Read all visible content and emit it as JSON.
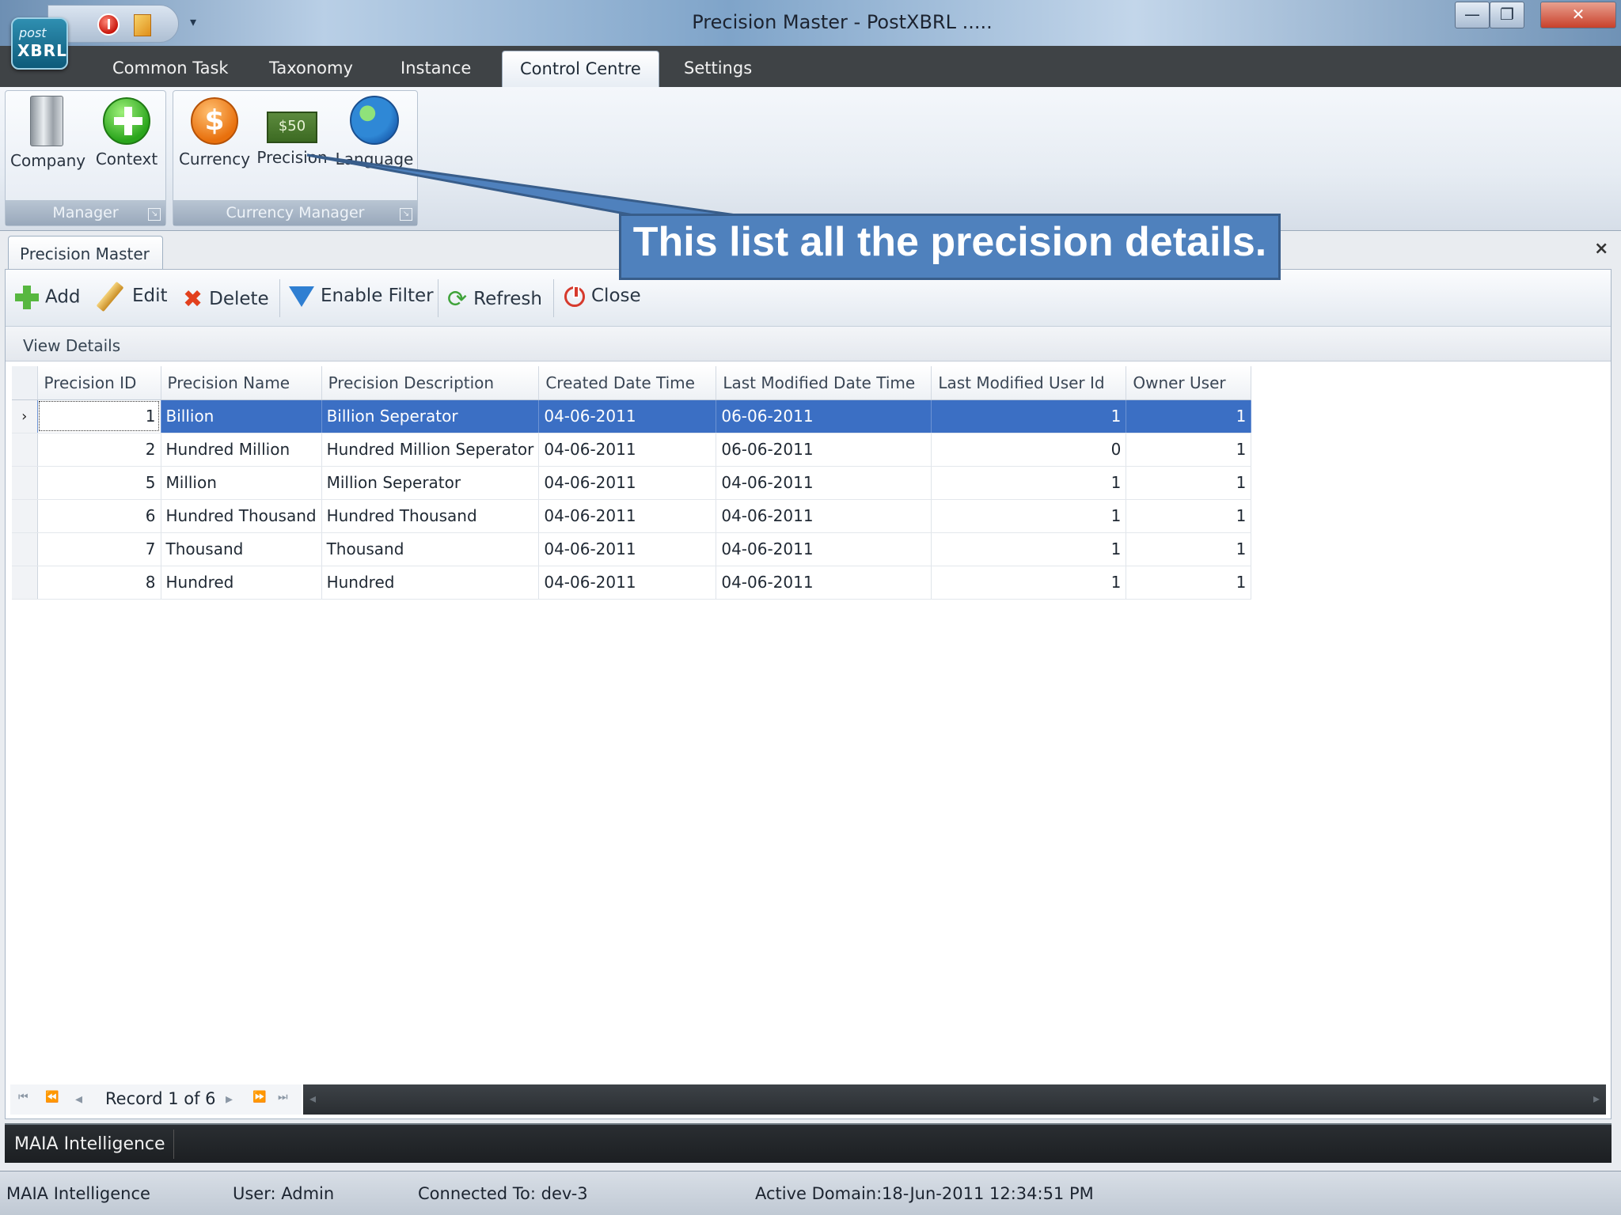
{
  "window": {
    "title": "Precision Master - PostXBRL .....",
    "logo_top": "post",
    "logo_bottom": "XBRL",
    "qat_arrow": "▾",
    "min_glyph": "—",
    "max_glyph": "❐",
    "close_glyph": "✕"
  },
  "ribbon_tabs": [
    {
      "label": "Common Task"
    },
    {
      "label": "Taxonomy"
    },
    {
      "label": "Instance"
    },
    {
      "label": "Control Centre",
      "active": true
    },
    {
      "label": "Settings"
    }
  ],
  "ribbon": {
    "groups": [
      {
        "title": "Manager",
        "buttons": [
          "Company",
          "Context"
        ]
      },
      {
        "title": "Currency Manager",
        "buttons": [
          "Currency",
          "Precision",
          "Language"
        ]
      }
    ],
    "currency_glyph": "$",
    "precision_glyph": "$50"
  },
  "document_tab": {
    "label": "Precision Master",
    "close_glyph": "×"
  },
  "toolbar": {
    "add": "Add",
    "edit": "Edit",
    "delete": "Delete",
    "enable_filter": "Enable Filter",
    "refresh": "Refresh",
    "close": "Close"
  },
  "view_details": "View Details",
  "grid": {
    "columns": [
      "Precision ID",
      "Precision Name",
      "Precision Description",
      "Created Date Time",
      "Last Modified Date Time",
      "Last Modified User Id",
      "Owner User"
    ],
    "rows": [
      {
        "id": "1",
        "name": "Billion",
        "description": "Billion  Seperator",
        "created": "04-06-2011",
        "modified": "06-06-2011",
        "modified_user": "1",
        "owner": "1",
        "selected": true
      },
      {
        "id": "2",
        "name": "Hundred Million",
        "description": "Hundred Million Seperator",
        "created": "04-06-2011",
        "modified": "06-06-2011",
        "modified_user": "0",
        "owner": "1"
      },
      {
        "id": "5",
        "name": "Million",
        "description": " Million Seperator",
        "created": "04-06-2011",
        "modified": "04-06-2011",
        "modified_user": "1",
        "owner": "1"
      },
      {
        "id": "6",
        "name": "Hundred Thousand",
        "description": "Hundred Thousand",
        "created": "04-06-2011",
        "modified": "04-06-2011",
        "modified_user": "1",
        "owner": "1"
      },
      {
        "id": "7",
        "name": "Thousand",
        "description": "Thousand",
        "created": "04-06-2011",
        "modified": "04-06-2011",
        "modified_user": "1",
        "owner": "1"
      },
      {
        "id": "8",
        "name": "Hundred",
        "description": "Hundred",
        "created": "04-06-2011",
        "modified": "04-06-2011",
        "modified_user": "1",
        "owner": "1"
      }
    ],
    "row_indicator": "›"
  },
  "navigator": {
    "record_text": "Record 1 of 6",
    "first": "⏮",
    "prev_page": "⏪",
    "prev": "◂",
    "next": "▸",
    "next_page": "⏩",
    "last": "⏭",
    "scroll_left": "◂",
    "scroll_right": "▸"
  },
  "bottom_panel": {
    "tab": "MAIA Intelligence"
  },
  "status_bar": {
    "app": "MAIA Intelligence",
    "user": "User: Admin",
    "connected": "Connected To: dev-3",
    "domain": "Active Domain:",
    "datetime": "18-Jun-2011 12:34:51 PM"
  },
  "annotation": {
    "text": "This list all the precision details."
  },
  "colors": {
    "selection": "#3b6fc4",
    "callout_fill": "#4f81bd",
    "callout_border": "#385d8a",
    "tab_bar": "#3f4346"
  }
}
